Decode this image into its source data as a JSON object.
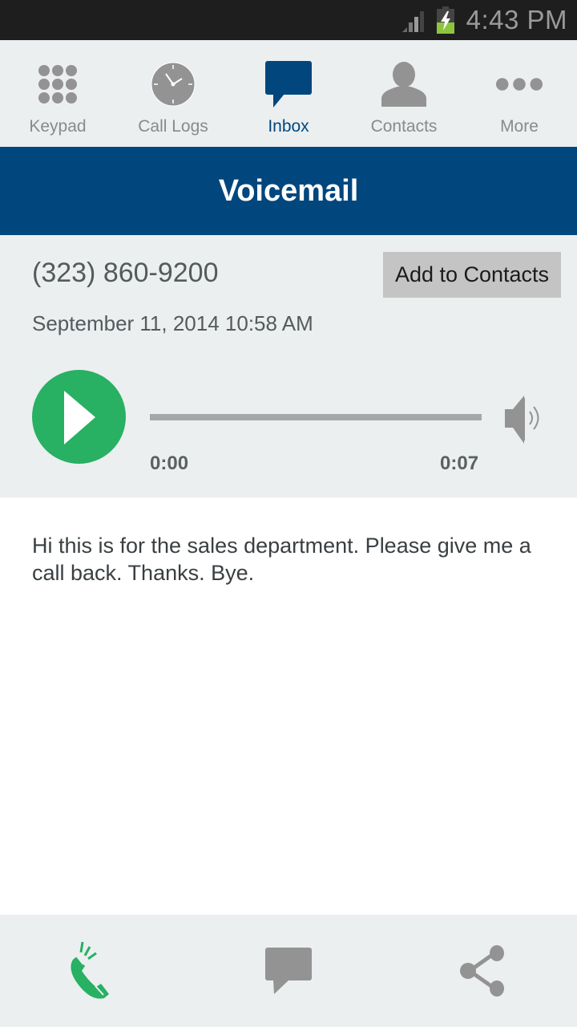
{
  "status_bar": {
    "time": "4:43 PM",
    "signal_icon": "signal-strength-icon",
    "battery_icon": "battery-charging-icon"
  },
  "top_nav": {
    "active": "Inbox",
    "items": [
      {
        "label": "Keypad",
        "icon": "keypad-icon"
      },
      {
        "label": "Call Logs",
        "icon": "clock-icon"
      },
      {
        "label": "Inbox",
        "icon": "chat-bubble-icon"
      },
      {
        "label": "Contacts",
        "icon": "person-icon"
      },
      {
        "label": "More",
        "icon": "more-dots-icon"
      }
    ]
  },
  "header": {
    "title": "Voicemail"
  },
  "voicemail": {
    "phone_number": "(323) 860-9200",
    "add_contact_label": "Add to Contacts",
    "datetime": "September 11, 2014 10:58 AM",
    "player": {
      "current_time": "0:00",
      "duration": "0:07",
      "progress_fraction": 0
    },
    "transcript": "Hi this is for the sales department. Please give me a call back. Thanks. Bye."
  },
  "bottom_actions": [
    {
      "name": "call-back",
      "icon": "phone-call-icon"
    },
    {
      "name": "message",
      "icon": "message-icon"
    },
    {
      "name": "share",
      "icon": "share-icon"
    }
  ],
  "colors": {
    "brand_blue": "#01467d",
    "play_green": "#28b063",
    "icon_gray": "#939393",
    "panel_bg": "#ebeff0"
  }
}
